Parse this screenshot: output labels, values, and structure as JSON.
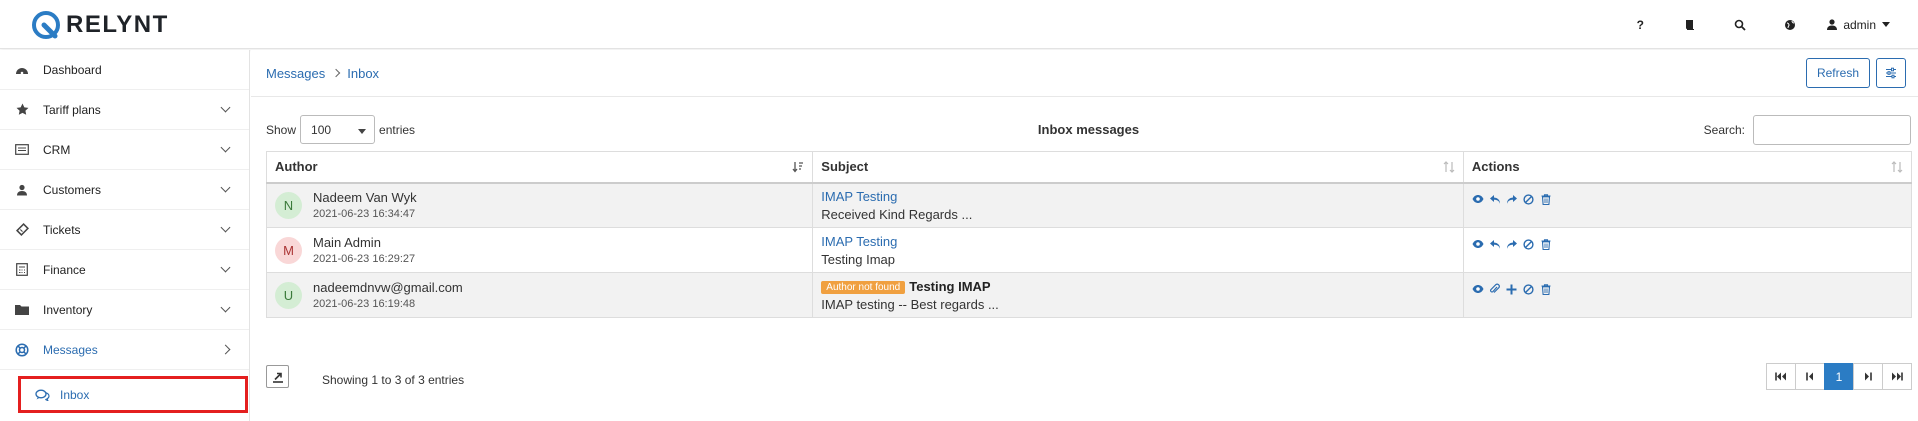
{
  "brand": {
    "name": "RELYNT"
  },
  "topbar": {
    "help_label": "?",
    "user_label": "admin"
  },
  "sidebar": {
    "items": [
      {
        "label": "Dashboard"
      },
      {
        "label": "Tariff plans"
      },
      {
        "label": "CRM"
      },
      {
        "label": "Customers"
      },
      {
        "label": "Tickets"
      },
      {
        "label": "Finance"
      },
      {
        "label": "Inventory"
      },
      {
        "label": "Messages"
      }
    ],
    "sub_item": {
      "label": "Inbox"
    }
  },
  "breadcrumb": {
    "parent": "Messages",
    "current": "Inbox"
  },
  "toolbar": {
    "refresh_label": "Refresh"
  },
  "table": {
    "show_label": "Show",
    "page_size": "100",
    "entries_label": "entries",
    "title": "Inbox messages",
    "search_label": "Search:",
    "columns": [
      "Author",
      "Subject",
      "Actions"
    ],
    "rows": [
      {
        "initial": "N",
        "author": "Nadeem Van Wyk",
        "date": "2021-06-23 16:34:47",
        "subject": "IMAP Testing",
        "preview": "Received Kind Regards  ..."
      },
      {
        "initial": "M",
        "author": "Main Admin",
        "date": "2021-06-23 16:29:27",
        "subject": "IMAP Testing",
        "preview": "Testing Imap"
      },
      {
        "initial": "U",
        "author": "nadeemdnvw@gmail.com",
        "date": "2021-06-23 16:19:48",
        "badge": "Author not found",
        "subject": "Testing IMAP",
        "preview": "IMAP testing -- Best regards  ..."
      }
    ],
    "info": "Showing 1 to 3 of 3 entries",
    "current_page": "1"
  },
  "colors": {
    "accent": "#2b6cb0",
    "highlight_border": "#e41f1f",
    "badge": "#f0a040"
  }
}
